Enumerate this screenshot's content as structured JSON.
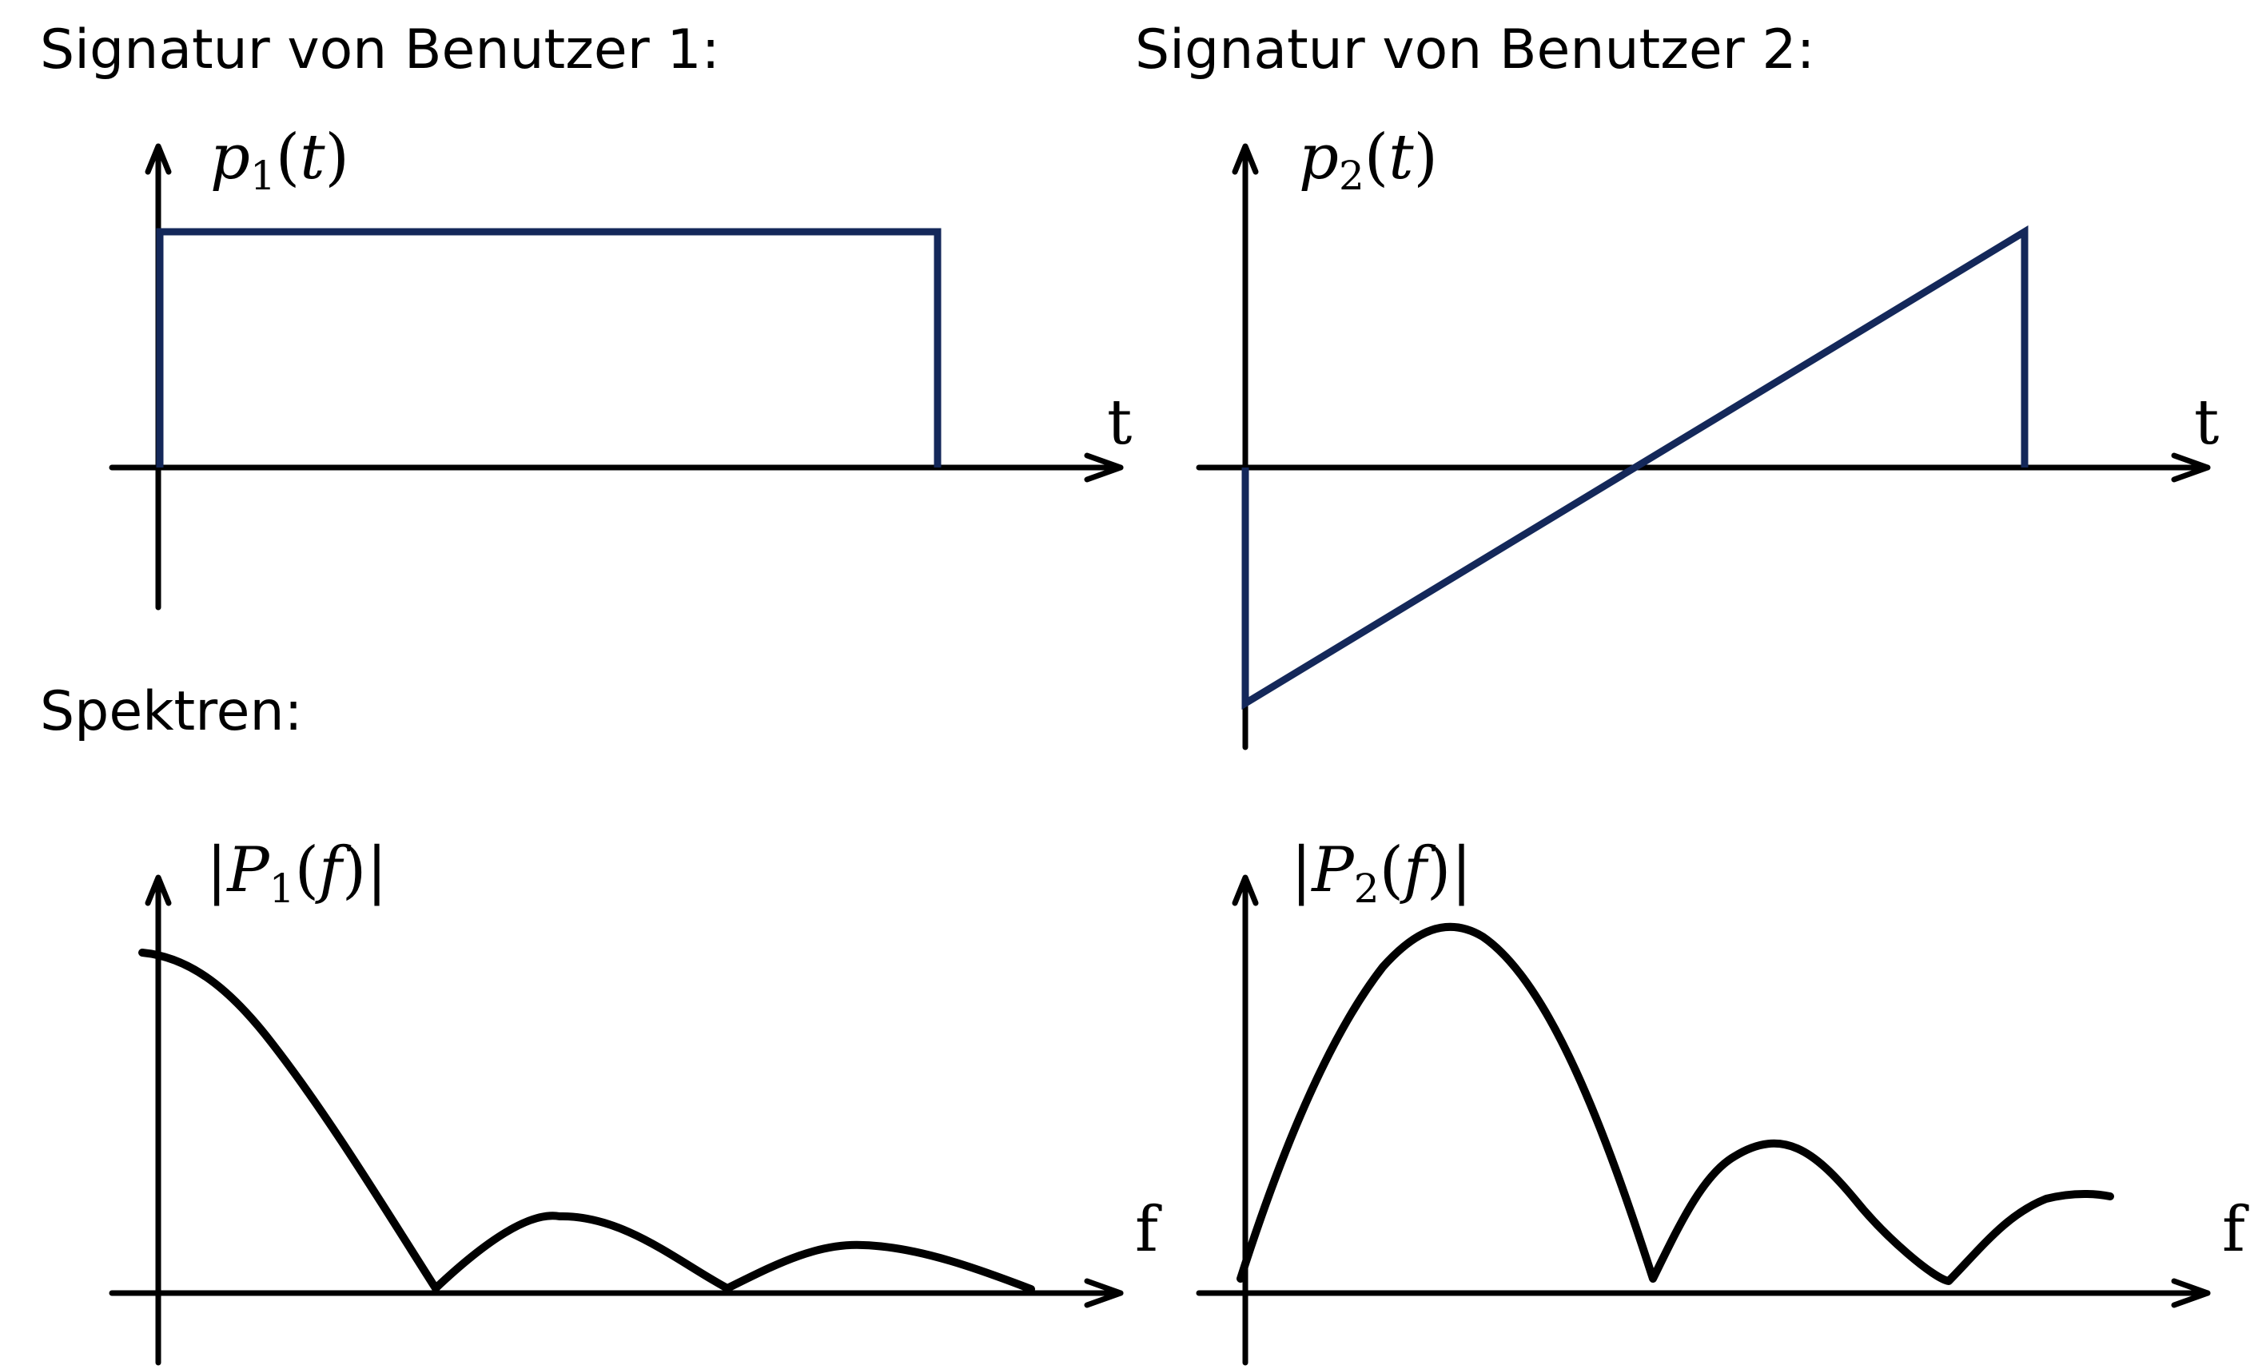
{
  "headings": {
    "user1": "Signatur von Benutzer 1:",
    "user2": "Signatur von Benutzer 2:",
    "spectra": "Spektren:"
  },
  "plots": {
    "p1": {
      "ylabel_symbol": "p",
      "ylabel_sub": "1",
      "ylabel_open": "(",
      "ylabel_arg": "t",
      "ylabel_close": ")",
      "xlabel": "t"
    },
    "p2": {
      "ylabel_symbol": "p",
      "ylabel_sub": "2",
      "ylabel_open": "(",
      "ylabel_arg": "t",
      "ylabel_close": ")",
      "xlabel": "t"
    },
    "P1": {
      "ylabel_open_bar": "|",
      "ylabel_symbol": "P",
      "ylabel_sub": "1",
      "ylabel_open": "(",
      "ylabel_arg": "f",
      "ylabel_close": ")",
      "ylabel_close_bar": "|",
      "xlabel": "f"
    },
    "P2": {
      "ylabel_open_bar": "|",
      "ylabel_symbol": "P",
      "ylabel_sub": "2",
      "ylabel_open": "(",
      "ylabel_arg": "f",
      "ylabel_close": ")",
      "ylabel_close_bar": "|",
      "xlabel": "f"
    }
  },
  "colors": {
    "signal": "#14285a",
    "axis": "#000000",
    "spectrum": "#000000"
  }
}
